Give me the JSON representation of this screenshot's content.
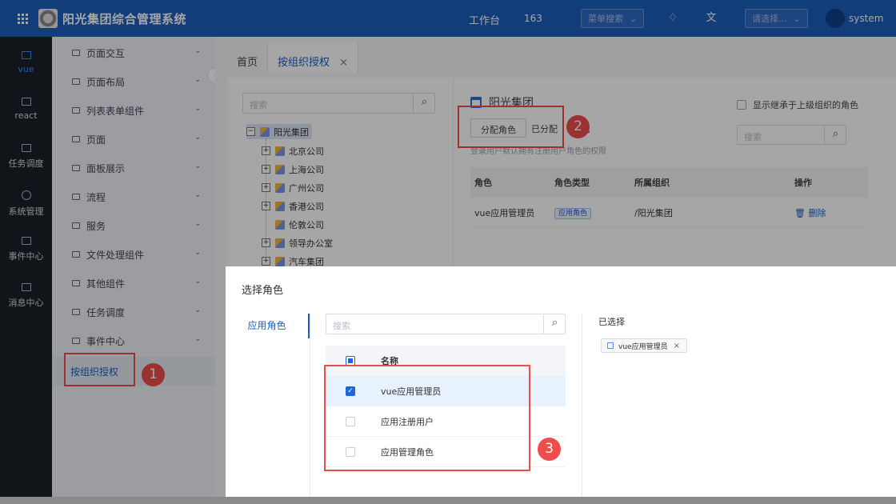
{
  "topbar": {
    "title": "阳光集团综合管理系统",
    "workbench": "工作台",
    "count": "163",
    "menu_search_placeholder": "菜单搜索",
    "select_placeholder": "请选择...",
    "username": "system",
    "icons": [
      "apps-icon",
      "bell-icon",
      "translate-icon",
      "avatar"
    ]
  },
  "left_nav": [
    {
      "label": "vue",
      "icon": "folder-icon",
      "active": true
    },
    {
      "label": "react",
      "icon": "folder-icon"
    },
    {
      "label": "任务调度",
      "icon": "folder-icon"
    },
    {
      "label": "系统管理",
      "icon": "gear-icon"
    },
    {
      "label": "事件中心",
      "icon": "folder-icon"
    },
    {
      "label": "消息中心",
      "icon": "folder-icon"
    }
  ],
  "submenu": [
    {
      "label": "页面交互"
    },
    {
      "label": "页面布局"
    },
    {
      "label": "列表表单组件"
    },
    {
      "label": "页面"
    },
    {
      "label": "面板展示"
    },
    {
      "label": "流程"
    },
    {
      "label": "服务"
    },
    {
      "label": "文件处理组件"
    },
    {
      "label": "其他组件"
    },
    {
      "label": "任务调度"
    },
    {
      "label": "事件中心"
    },
    {
      "label": "按组织授权",
      "active": true
    }
  ],
  "tabs": [
    {
      "label": "首页"
    },
    {
      "label": "按组织授权",
      "active": true,
      "close": "×"
    }
  ],
  "tree": {
    "search_placeholder": "搜索",
    "root": {
      "label": "阳光集团",
      "toggle": "−"
    },
    "children": [
      {
        "label": "北京公司",
        "toggle": "+"
      },
      {
        "label": "上海公司",
        "toggle": "+"
      },
      {
        "label": "广州公司",
        "toggle": "+"
      },
      {
        "label": "香港公司",
        "toggle": "+"
      },
      {
        "label": "伦敦公司"
      },
      {
        "label": "领导办公室",
        "toggle": "+"
      },
      {
        "label": "汽车集团",
        "toggle": "+"
      }
    ]
  },
  "org_panel": {
    "title": "阳光集团",
    "show_inherited": "显示继承于上级组织的角色",
    "assign_button": "分配角色",
    "assigned_label": "已分配",
    "assigned_suffix": "色",
    "note": "登录用户默认拥有注册用户角色的权限",
    "search_placeholder": "搜索",
    "columns": [
      "角色",
      "角色类型",
      "所属组织",
      "操作"
    ],
    "rows": [
      {
        "role": "vue应用管理员",
        "type": "应用角色",
        "org": "/阳光集团",
        "action": "删除"
      }
    ]
  },
  "dialog": {
    "title": "选择角色",
    "tab": "应用角色",
    "search_placeholder": "搜索",
    "table_header": "名称",
    "roles": [
      {
        "name": "vue应用管理员",
        "checked": true
      },
      {
        "name": "应用注册用户",
        "checked": false
      },
      {
        "name": "应用管理角色",
        "checked": false
      }
    ],
    "selected_title": "已选择",
    "selected_chip": "vue应用管理员",
    "chip_close": "×"
  },
  "annotations": [
    {
      "number": "1",
      "color": "#ef4c4c"
    },
    {
      "number": "2",
      "color": "#ef4c4c"
    },
    {
      "number": "3",
      "color": "#ef4c4c"
    }
  ]
}
